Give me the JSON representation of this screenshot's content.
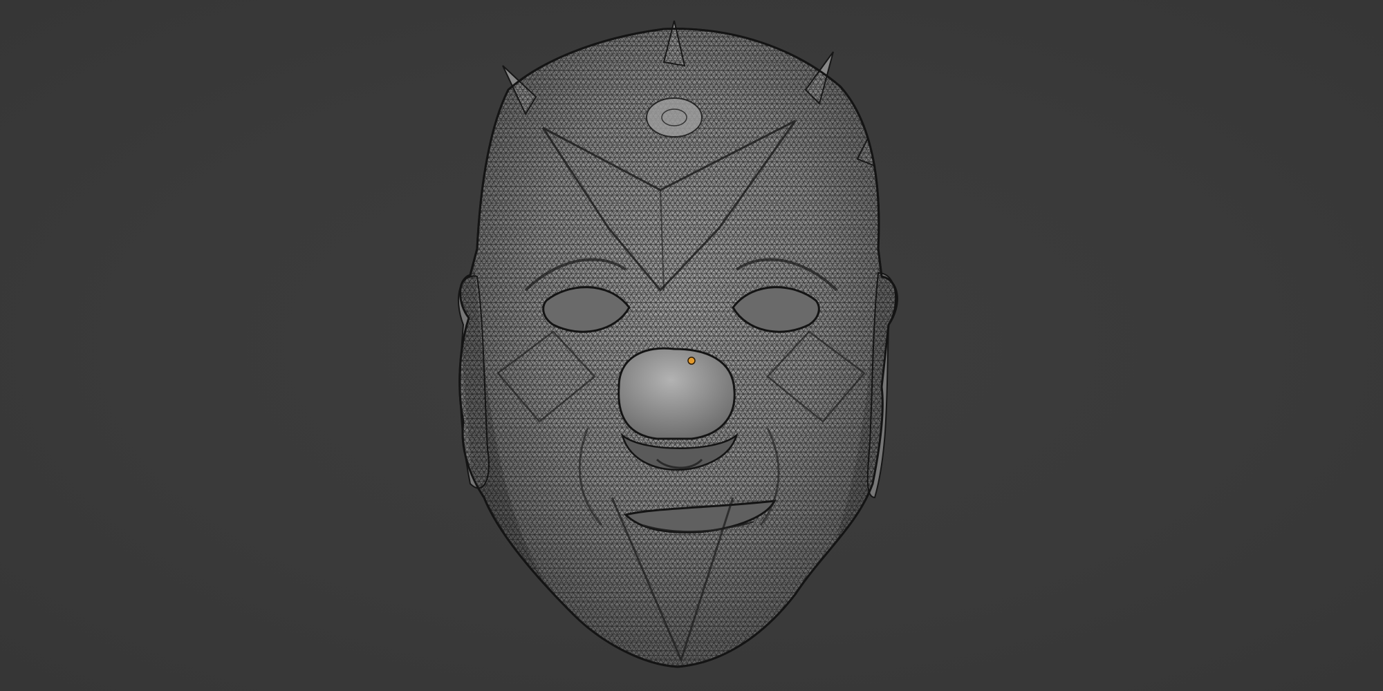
{
  "viewport": {
    "background_color": "#3a3a3a",
    "mesh_base_color": "#8a8a8a",
    "wire_color": "#1c1c1c",
    "origin_color": "#e39a2c",
    "display_mode": "wireframe-overlay"
  },
  "scene": {
    "object_icon": "clown-head-mesh-icon",
    "origin_icon": "object-origin-icon"
  }
}
